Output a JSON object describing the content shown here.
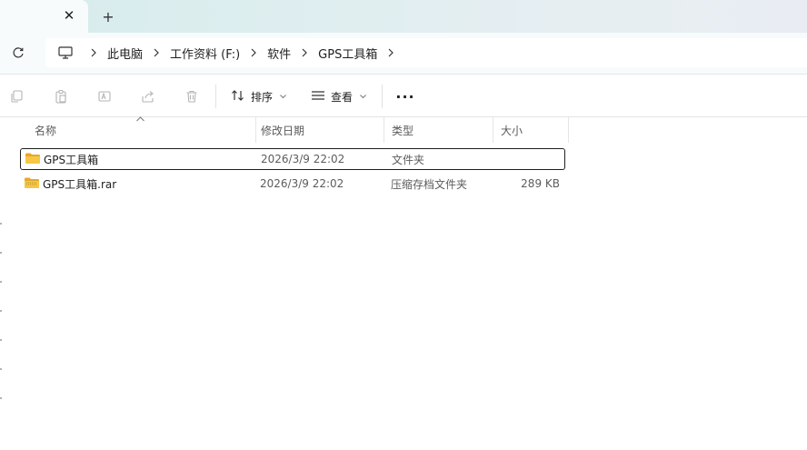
{
  "titlebar": {
    "close_glyph": "✕",
    "new_tab_glyph": "+"
  },
  "address": {
    "crumbs": [
      "此电脑",
      "工作资料 (F:)",
      "软件",
      "GPS工具箱"
    ]
  },
  "toolbar": {
    "sort_label": "排序",
    "view_label": "查看",
    "more_glyph": "···"
  },
  "columns": {
    "name": "名称",
    "date": "修改日期",
    "type": "类型",
    "size": "大小"
  },
  "files": [
    {
      "name": "GPS工具箱",
      "date": "2026/3/9 22:02",
      "type": "文件夹",
      "size": "",
      "icon": "folder-icon"
    },
    {
      "name": "GPS工具箱.rar",
      "date": "2026/3/9 22:02",
      "type": "压缩存档文件夹",
      "size": "289 KB",
      "icon": "zip-folder-icon"
    }
  ],
  "colors": {
    "folder": "#f4c542",
    "accent": "#0067c0"
  }
}
